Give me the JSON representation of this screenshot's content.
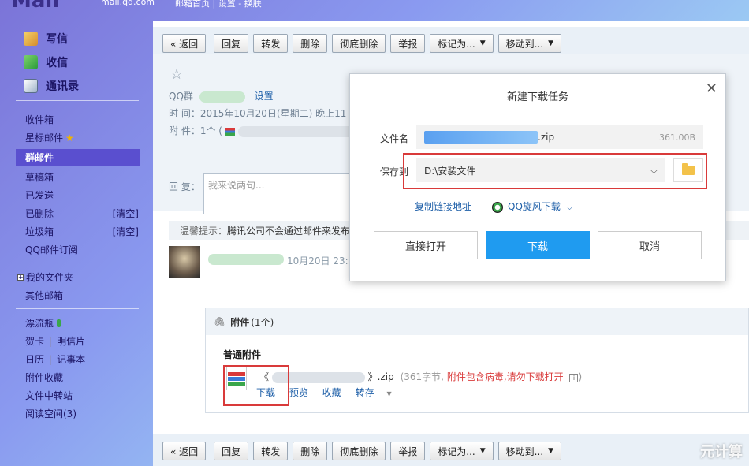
{
  "brand": {
    "logo": "Mail",
    "domain": "mail.qq.com",
    "top_links": "邮箱首页 | 设置 - 换肤"
  },
  "sidebar": {
    "primary": [
      {
        "label": "写信",
        "icon": "compose-icon"
      },
      {
        "label": "收信",
        "icon": "inbox-download-icon"
      },
      {
        "label": "通讯录",
        "icon": "contacts-icon"
      }
    ],
    "folders": [
      {
        "label": "收件箱",
        "right": ""
      },
      {
        "label": "星标邮件",
        "right": ""
      },
      {
        "label": "群邮件",
        "right": ""
      },
      {
        "label": "草稿箱",
        "right": ""
      },
      {
        "label": "已发送",
        "right": ""
      },
      {
        "label": "已删除",
        "right": "[清空]"
      },
      {
        "label": "垃圾箱",
        "right": "[清空]"
      },
      {
        "label": "QQ邮件订阅",
        "right": ""
      }
    ],
    "my_folders": "我的文件夹",
    "other_mailbox": "其他邮箱",
    "apps": {
      "bottle": "漂流瓶",
      "card": "贺卡",
      "postcard": "明信片",
      "calendar": "日历",
      "notes": "记事本",
      "attachments": "附件收藏",
      "transfer": "文件中转站",
      "reading": "阅读空间(3)"
    }
  },
  "toolbar": {
    "back": "« 返回",
    "reply": "回复",
    "forward": "转发",
    "delete": "删除",
    "delete_permanent": "彻底删除",
    "report": "举报",
    "mark_as": "标记为...",
    "move_to": "移动到..."
  },
  "mail": {
    "star": "☆",
    "group_label": "QQ群",
    "settings_link": "设置",
    "time_label": "时 间：",
    "time_value": "2015年10月20日(星期二) 晚上11",
    "attach_label": "附 件：",
    "attach_value": "1个 (",
    "reply_label": "回 复：",
    "reply_placeholder": "我来说两句...",
    "tip_label": "温馨提示：",
    "tip_text": "腾讯公司不会通过邮件来发布",
    "sender_date": "10月20日 23:",
    "attach_count_label": "附件",
    "attach_count": "(1个)",
    "normal_attach": "普通附件",
    "file_prefix": "《",
    "file_ext": "》.zip",
    "file_meta_open": "(",
    "file_size": "361字节, ",
    "file_warning": "附件包含病毒,请勿下载打开",
    "file_meta_close": ")",
    "actions": {
      "download": "下载",
      "preview": "预览",
      "collect": "收藏",
      "save_to": "转存"
    }
  },
  "dialog": {
    "title": "新建下载任务",
    "filename_label": "文件名",
    "filename_value": ".zip",
    "filename_size": "361.00B",
    "saveto_label": "保存到",
    "saveto_value": "D:\\安装文件",
    "copy_link": "复制链接地址",
    "qq_download": "QQ旋风下载",
    "open_directly": "直接打开",
    "download": "下载",
    "cancel": "取消"
  },
  "watermark": "元计算"
}
